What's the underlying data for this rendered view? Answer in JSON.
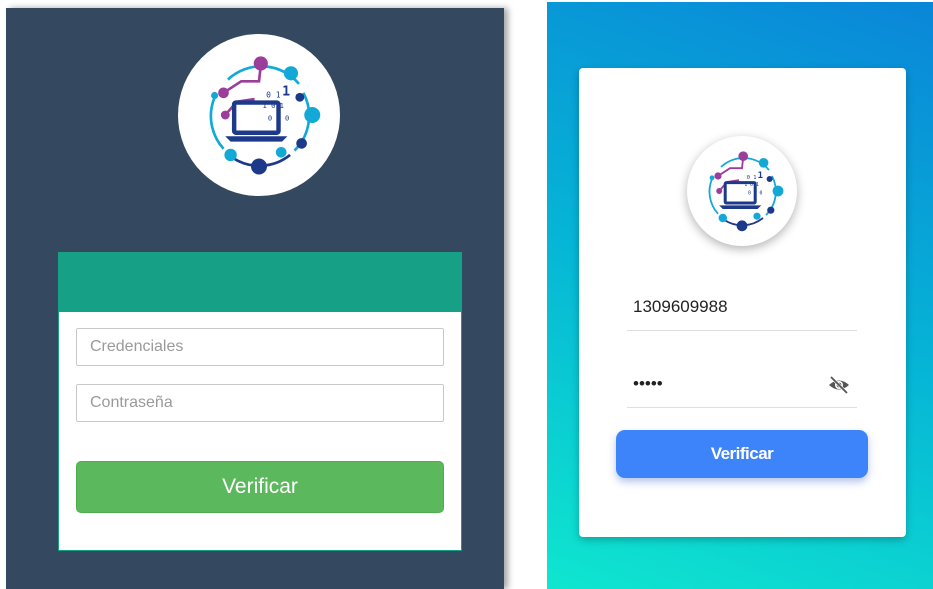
{
  "left_form": {
    "credentials_placeholder": "Credenciales",
    "password_placeholder": "Contraseña",
    "verify_label": "Verificar"
  },
  "right_form": {
    "username_value": "1309609988",
    "password_value": "•••••",
    "verify_label": "Verificar",
    "password_toggle_icon": "eye-off-icon"
  },
  "colors": {
    "left_background": "#34485f",
    "left_card_header": "#16a085",
    "left_button": "#5cb85c",
    "right_gradient_top": "#0a86d8",
    "right_gradient_bottom": "#0fe6cf",
    "right_button": "#3d84fb",
    "logo_purple": "#9b3d9b",
    "logo_cyan": "#13a9d6",
    "logo_navy": "#1d3a8a"
  },
  "logo": {
    "icon": "laptop-network-logo",
    "binary_digits": [
      "0",
      "1",
      "0",
      "1",
      "1",
      "0",
      "0",
      "1"
    ]
  }
}
